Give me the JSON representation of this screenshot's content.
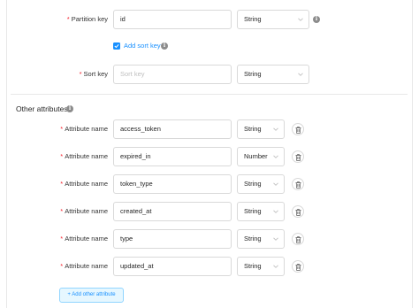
{
  "primary_key": {
    "partition_key": {
      "label": "Partition key",
      "value": "id",
      "type": "String"
    },
    "add_sort_key_label": "Add sort key",
    "add_sort_key_checked": true,
    "sort_key": {
      "label": "Sort key",
      "placeholder": "Sort key",
      "type": "String"
    }
  },
  "other_attributes": {
    "title": "Other attributes",
    "attribute_label": "Attribute name",
    "items": [
      {
        "name": "access_token",
        "type": "String"
      },
      {
        "name": "expired_in",
        "type": "Number"
      },
      {
        "name": "token_type",
        "type": "String"
      },
      {
        "name": "created_at",
        "type": "String"
      },
      {
        "name": "type",
        "type": "String"
      },
      {
        "name": "updated_at",
        "type": "String"
      }
    ],
    "add_button_label": "+ Add other attribute"
  },
  "icons": {
    "info": "info-circle-icon",
    "delete": "trash-icon",
    "chevron": "chevron-down-icon",
    "check": "check-icon"
  },
  "colors": {
    "accent": "#1890ff",
    "required": "#f5222d",
    "border": "#d9d9d9"
  }
}
